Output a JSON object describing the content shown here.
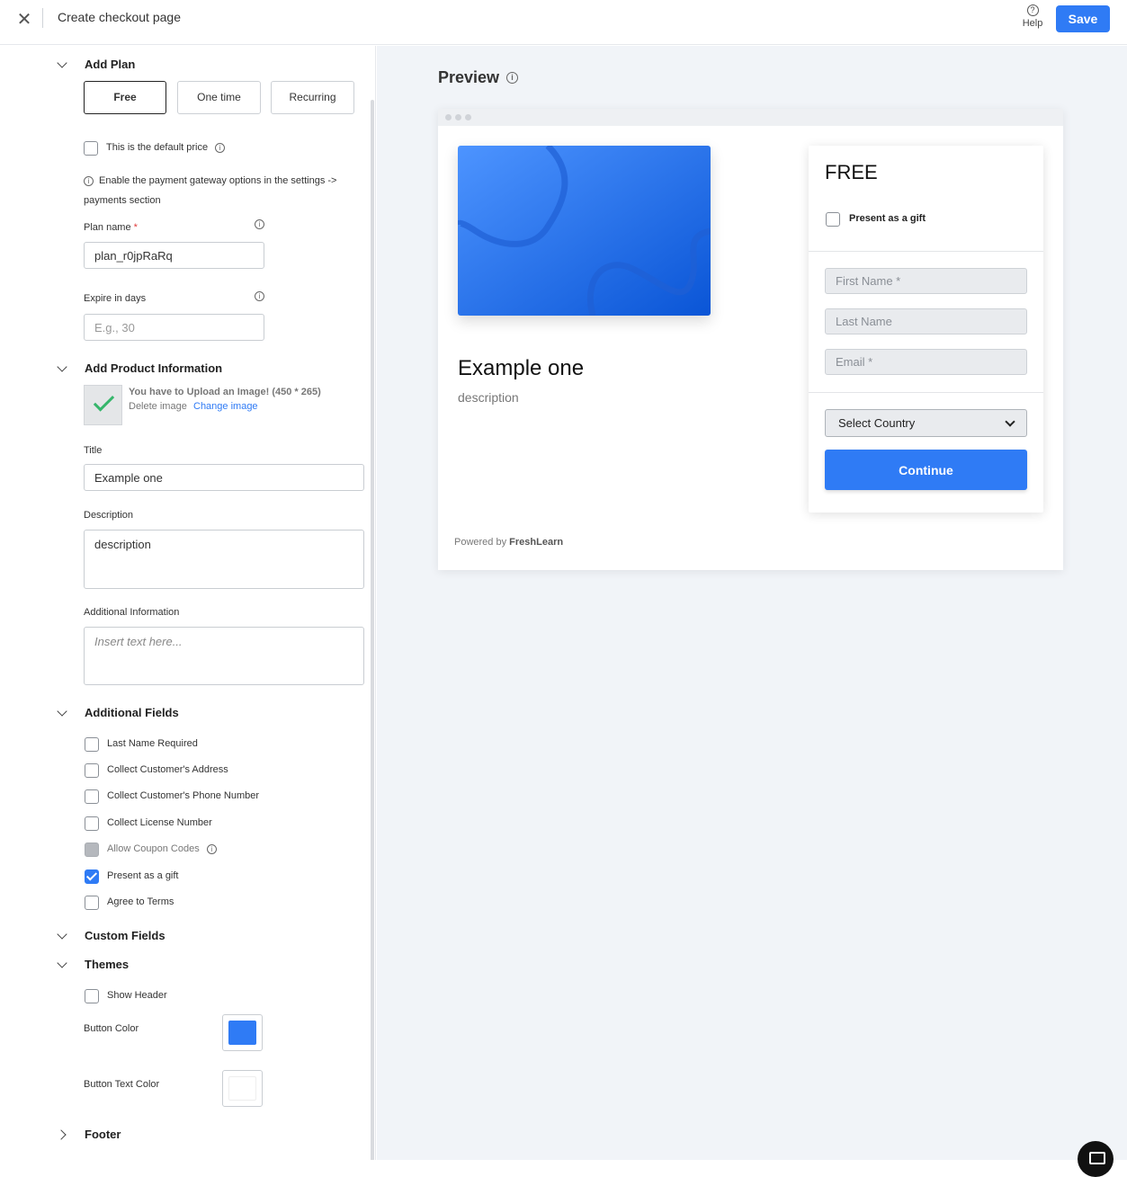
{
  "header": {
    "title": "Create checkout page",
    "help_label": "Help",
    "save_label": "Save"
  },
  "sections": {
    "add_plan": "Add Plan",
    "add_product": "Add Product Information",
    "additional_fields": "Additional Fields",
    "custom_fields": "Custom Fields",
    "themes": "Themes",
    "footer": "Footer"
  },
  "plan_types": [
    "Free",
    "One time",
    "Recurring"
  ],
  "selected_plan": "Free",
  "default_price_label": "This is the default price",
  "gateway_note_line1": "Enable the payment gateway options in the settings ->",
  "gateway_note_line2": "payments section",
  "plan_name": {
    "label": "Plan name",
    "required_mark": "*",
    "value": "plan_r0jpRaRq"
  },
  "expire": {
    "label": "Expire in days",
    "placeholder": "E.g., 30"
  },
  "product": {
    "upload_msg": "You have to Upload an Image! (450 * 265)",
    "delete_label": "Delete image",
    "change_label": "Change image",
    "title_label": "Title",
    "title_value": "Example one",
    "description_label": "Description",
    "description_value": "description",
    "additional_label": "Additional Information",
    "additional_placeholder": "Insert text here..."
  },
  "additional_fields": [
    {
      "label": "Last Name Required",
      "checked": false,
      "disabled": false
    },
    {
      "label": "Collect Customer's Address",
      "checked": false,
      "disabled": false
    },
    {
      "label": "Collect Customer's Phone Number",
      "checked": false,
      "disabled": false
    },
    {
      "label": "Collect License Number",
      "checked": false,
      "disabled": false
    },
    {
      "label": "Allow Coupon Codes",
      "checked": false,
      "disabled": true
    },
    {
      "label": "Present as a gift",
      "checked": true,
      "disabled": false
    },
    {
      "label": "Agree to Terms",
      "checked": false,
      "disabled": false
    }
  ],
  "themes": {
    "show_header_label": "Show Header",
    "button_color_label": "Button Color",
    "button_color": "#2f7bf5",
    "button_text_color_label": "Button Text Color",
    "button_text_color": "#ffffff"
  },
  "preview": {
    "heading": "Preview",
    "product_title": "Example one",
    "product_desc": "description",
    "price": "FREE",
    "gift_label": "Present as a gift",
    "first_name_ph": "First Name *",
    "last_name_ph": "Last Name",
    "email_ph": "Email *",
    "country_select": "Select Country",
    "continue_label": "Continue",
    "powered_prefix": "Powered by",
    "powered_brand": "FreshLearn"
  }
}
